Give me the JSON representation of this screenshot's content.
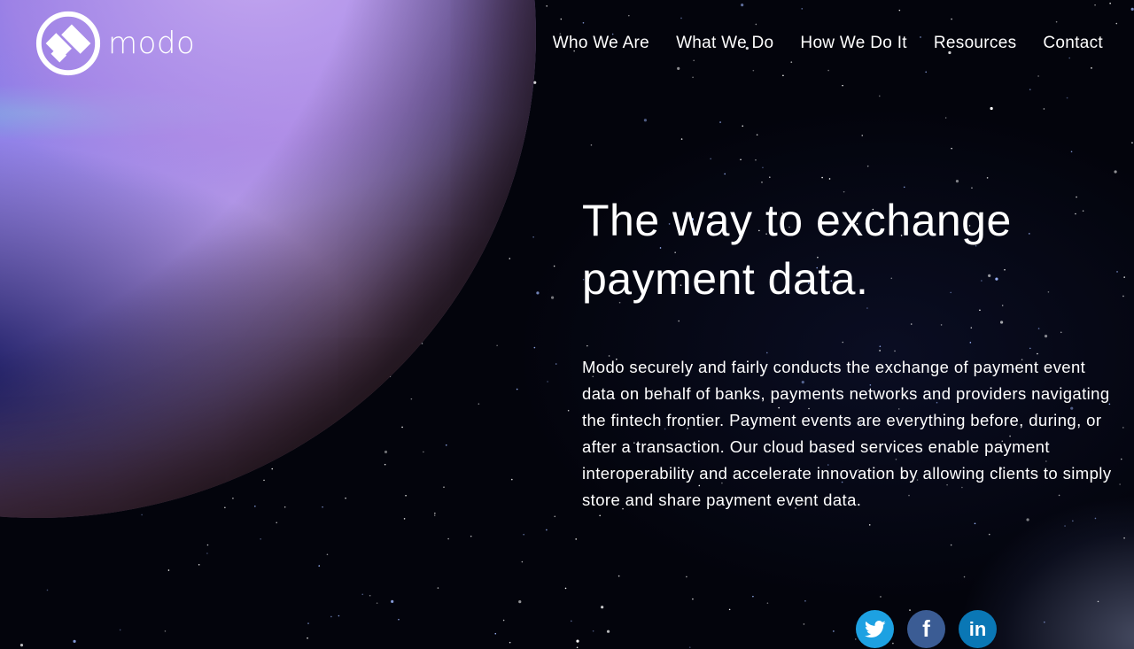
{
  "brand": {
    "name": "modo",
    "logo_icon": "modo-logo-icon"
  },
  "nav": {
    "items": [
      {
        "label": "Who We Are"
      },
      {
        "label": "What We Do"
      },
      {
        "label": "How We Do It"
      },
      {
        "label": "Resources"
      },
      {
        "label": "Contact"
      }
    ]
  },
  "hero": {
    "title_line1": "The way to exchange",
    "title_line2": "payment data.",
    "body": "Modo securely and fairly conducts the exchange of payment event data on behalf of banks, payments networks and providers navigating the fintech frontier. Payment events are everything before, during, or after a transaction. Our cloud based services enable payment interoperability and accelerate innovation by allowing clients to simply store and share payment event data."
  },
  "social": {
    "items": [
      {
        "name": "twitter",
        "icon": "twitter-icon",
        "color": "#1da1e2"
      },
      {
        "name": "facebook",
        "icon": "facebook-icon",
        "color": "#3b5c94",
        "glyph": "f"
      },
      {
        "name": "linkedin",
        "icon": "linkedin-icon",
        "color": "#0a77b5",
        "glyph": "in"
      }
    ]
  }
}
